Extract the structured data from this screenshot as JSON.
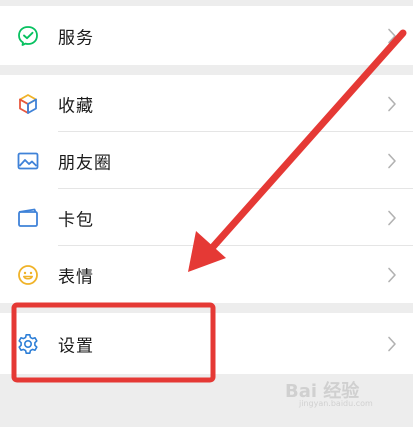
{
  "menu": {
    "service_label": "服务",
    "favorites_label": "收藏",
    "moments_label": "朋友圈",
    "cards_label": "卡包",
    "stickers_label": "表情",
    "settings_label": "设置"
  },
  "icons": {
    "service": "check-circle-icon",
    "favorites": "cube-icon",
    "moments": "picture-icon",
    "cards": "card-icon",
    "stickers": "smiley-icon",
    "settings": "gear-icon",
    "chevron": "chevron-right-icon"
  },
  "colors": {
    "background": "#ededed",
    "row_background": "#ffffff",
    "divider": "#e5e5e5",
    "text": "#1a1a1a",
    "chevron": "#b2b2b2",
    "service_green": "#07c160",
    "moments_blue": "#3f82d8",
    "settings_blue": "#2e7fd7",
    "sticker_yellow": "#f0b329",
    "annotation_red": "#e53935"
  },
  "watermark": {
    "brand": "Bai 经验",
    "sub": "jingyan.baidu.com"
  }
}
